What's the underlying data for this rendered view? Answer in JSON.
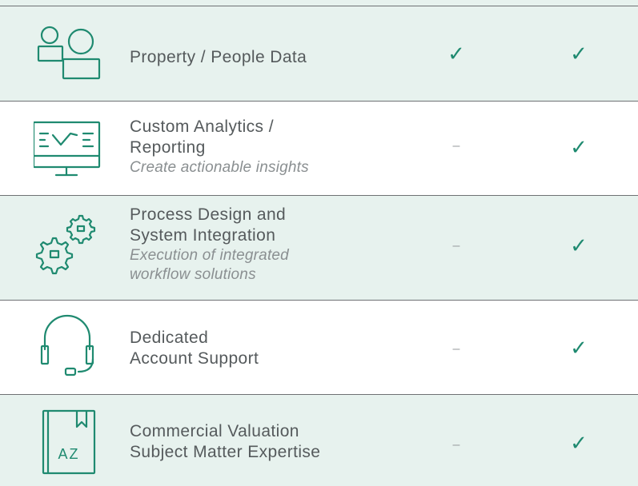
{
  "rows": [
    {
      "icon": "people-data-icon",
      "title_lines": [
        "Property / People Data"
      ],
      "subtitle_lines": [],
      "col1": "✓",
      "col2": "✓"
    },
    {
      "icon": "analytics-monitor-icon",
      "title_lines": [
        "Custom Analytics /",
        "Reporting"
      ],
      "subtitle_lines": [
        "Create actionable insights"
      ],
      "col1": "–",
      "col2": "✓"
    },
    {
      "icon": "gears-icon",
      "title_lines": [
        "Process Design and",
        "System Integration"
      ],
      "subtitle_lines": [
        "Execution of integrated",
        "workflow solutions"
      ],
      "col1": "–",
      "col2": "✓"
    },
    {
      "icon": "headset-icon",
      "title_lines": [
        "Dedicated",
        "Account Support"
      ],
      "subtitle_lines": [],
      "col1": "–",
      "col2": "✓"
    },
    {
      "icon": "az-book-icon",
      "icon_text": "AZ",
      "title_lines": [
        "Commercial Valuation",
        "Subject Matter Expertise"
      ],
      "subtitle_lines": [],
      "col1": "–",
      "col2": "✓"
    }
  ],
  "colors": {
    "shaded_row": "#e7f2ee",
    "accent": "#1f8a70",
    "text": "#555a5c",
    "subtext": "#8a8f91",
    "rule": "#6e7174"
  }
}
